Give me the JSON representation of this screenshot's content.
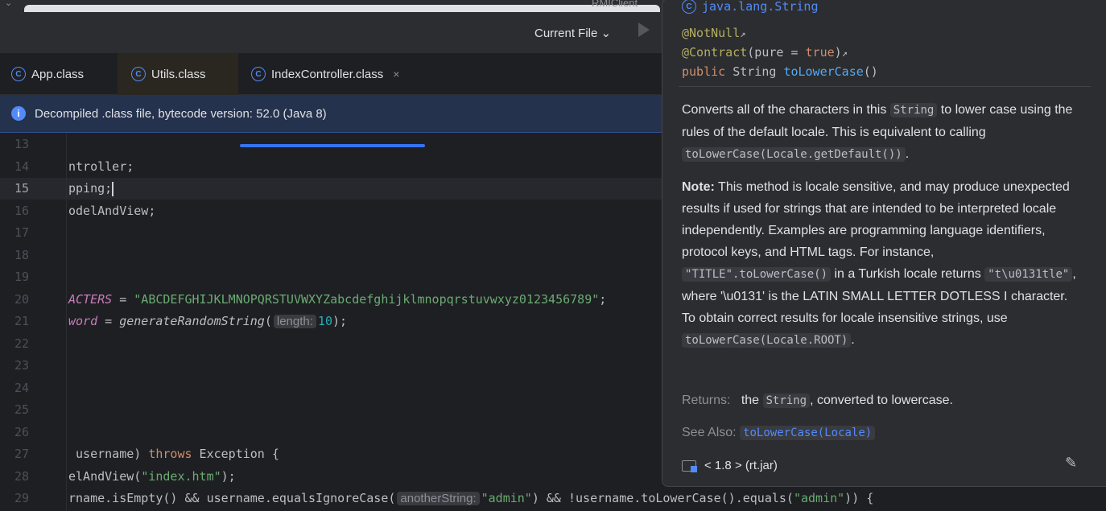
{
  "window": {
    "background_title": "RMIClient"
  },
  "toolbar": {
    "run_config": "Current File",
    "run_config_chevron": "⌄"
  },
  "tabs": [
    {
      "label": "App.class"
    },
    {
      "label": "Utils.class"
    },
    {
      "label": "IndexController.class",
      "active": true,
      "close": "×"
    }
  ],
  "banner": {
    "text": "Decompiled .class file, bytecode version: 52.0 (Java 8)"
  },
  "editor": {
    "current_line": 15,
    "lines": [
      {
        "n": "13",
        "seg": []
      },
      {
        "n": "14",
        "seg": [
          [
            "",
            "ntroller;"
          ]
        ]
      },
      {
        "n": "15",
        "seg": [
          [
            "",
            "pping;"
          ]
        ],
        "caret": true
      },
      {
        "n": "16",
        "seg": [
          [
            "",
            "odelAndView;"
          ]
        ]
      },
      {
        "n": "17",
        "seg": []
      },
      {
        "n": "18",
        "seg": []
      },
      {
        "n": "19",
        "seg": []
      },
      {
        "n": "20",
        "seg": [
          [
            "c",
            "ACTERS"
          ],
          [
            "",
            " = "
          ],
          [
            "s",
            "\"ABCDEFGHIJKLMNOPQRSTUVWXYZabcdefghijklmnopqrstuvwxyz0123456789\""
          ],
          [
            "",
            ";"
          ]
        ]
      },
      {
        "n": "21",
        "seg": [
          [
            "c",
            "word"
          ],
          [
            "",
            " = "
          ],
          [
            "i",
            "generateRandomString"
          ],
          [
            "",
            "("
          ],
          [
            "h",
            "length:"
          ],
          [
            "n",
            "10"
          ],
          [
            "",
            ");"
          ]
        ]
      },
      {
        "n": "22",
        "seg": []
      },
      {
        "n": "23",
        "seg": []
      },
      {
        "n": "24",
        "seg": []
      },
      {
        "n": "25",
        "seg": []
      },
      {
        "n": "26",
        "seg": []
      },
      {
        "n": "27",
        "seg": [
          [
            "",
            " username) "
          ],
          [
            "k",
            "throws"
          ],
          [
            "",
            " Exception {"
          ]
        ]
      },
      {
        "n": "28",
        "seg": [
          [
            "",
            "elAndView("
          ],
          [
            "s",
            "\"index.htm\""
          ],
          [
            "",
            ");"
          ]
        ]
      },
      {
        "n": "29",
        "seg": [
          [
            "",
            "rname.isEmpty() && username.equalsIgnoreCase("
          ],
          [
            "h",
            "anotherString:"
          ],
          [
            "s",
            "\"admin\""
          ],
          [
            "",
            ") && !username.toLowerCase().equals("
          ],
          [
            "s",
            "\"admin\""
          ],
          [
            "",
            ")) {"
          ]
        ]
      }
    ]
  },
  "doc": {
    "class_name": "java.lang.String",
    "annotation1": "@NotNull",
    "annotation2": "@Contract",
    "annotation2_args_open": "(pure = ",
    "annotation2_value": "true",
    "annotation2_close": ")",
    "sig_modifier": "public",
    "sig_type": " String ",
    "sig_method": "toLowerCase",
    "sig_parens": "()",
    "p1": [
      "Converts all of the characters in this ",
      "String",
      " to lower case using the rules of the default locale. This is equivalent to calling ",
      "toLowerCase(Locale.getDefault())",
      "."
    ],
    "p2_bold": "Note:",
    "p2": [
      " This method is locale sensitive, and may produce unexpected results if used for strings that are intended to be interpreted locale independently. Examples are programming language identifiers, protocol keys, and HTML tags. For instance, ",
      "\"TITLE\".toLowerCase()",
      " in a Turkish locale returns ",
      "\"t\\u0131tle\"",
      ", where '\\u0131' is the LATIN SMALL LETTER DOTLESS I character. To obtain correct results for locale insensitive strings, use ",
      "toLowerCase(Locale.ROOT)",
      "."
    ],
    "returns_label": "Returns:",
    "returns_pre": "the ",
    "returns_code": "String",
    "returns_post": ", converted to lowercase.",
    "see_also_label": "See Also:",
    "see_also_link": "toLowerCase(Locale)",
    "library": "< 1.8 > (rt.jar)"
  },
  "colors": {
    "accent": "#3574f0",
    "string": "#6aab73",
    "keyword": "#cf8e6d",
    "constant": "#c77dbb",
    "number": "#2aacb8"
  }
}
